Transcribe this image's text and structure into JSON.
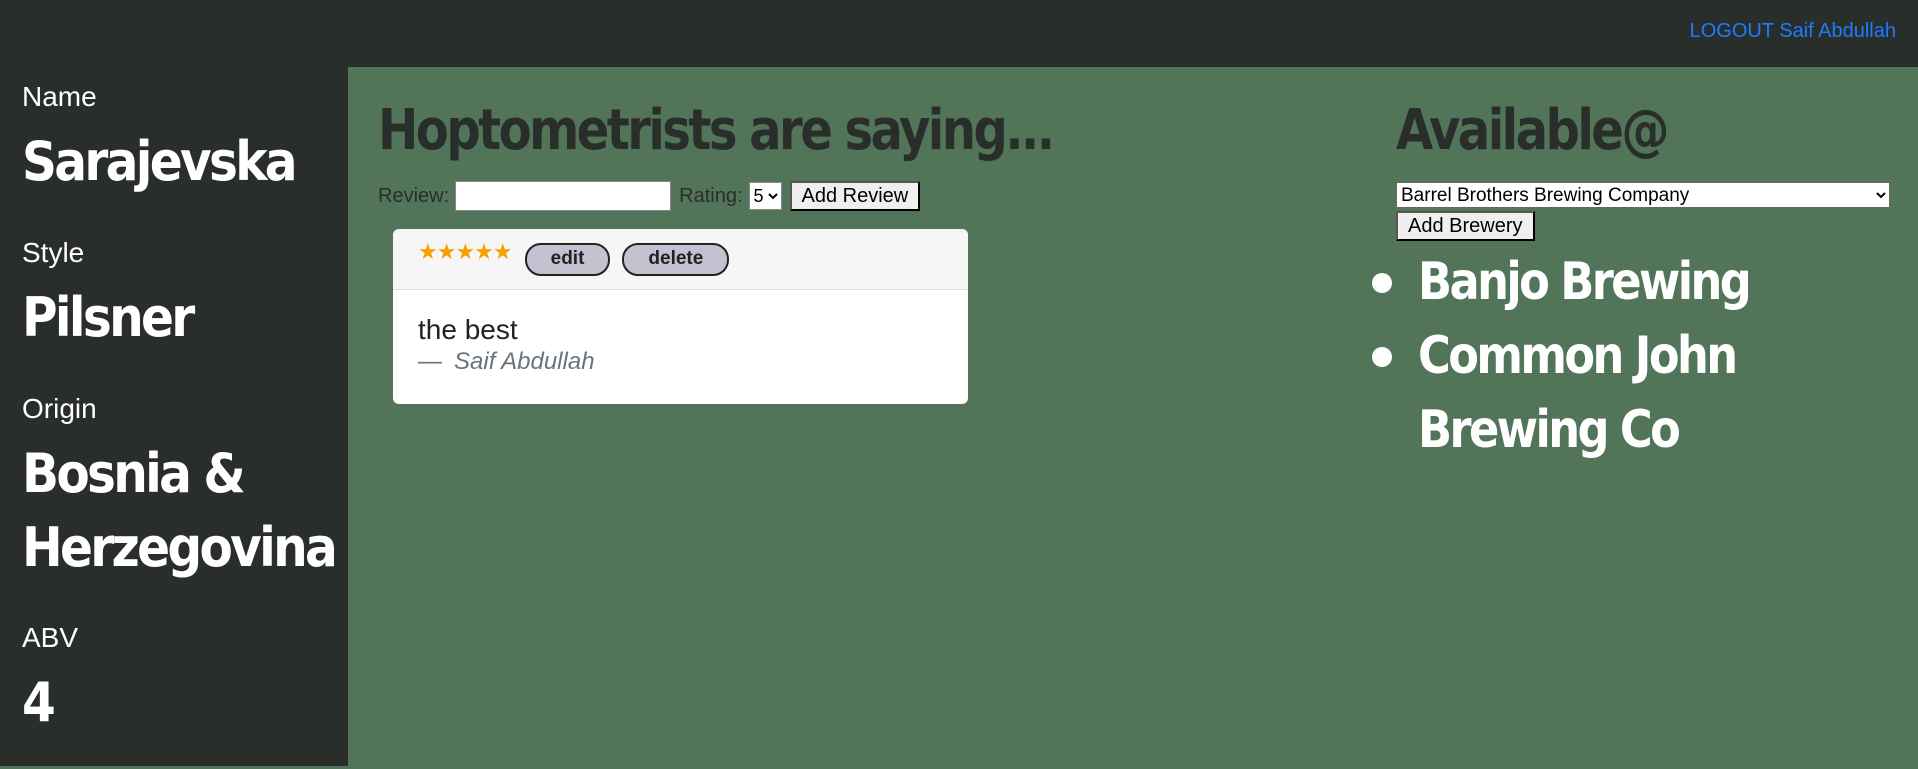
{
  "header": {
    "logout_label": "LOGOUT",
    "user_name": "Saif Abdullah"
  },
  "sidebar": {
    "name_label": "Name",
    "name_value": "Sarajevska",
    "style_label": "Style",
    "style_value": "Pilsner",
    "origin_label": "Origin",
    "origin_value": "Bosnia & Herzegovina",
    "abv_label": "ABV",
    "abv_value": "4"
  },
  "reviews": {
    "heading": "Hoptometrists are saying...",
    "review_label": "Review:",
    "review_value": "",
    "rating_label": "Rating:",
    "rating_selected": "5",
    "add_review_label": "Add Review",
    "items": [
      {
        "stars": "★★★★★",
        "rating": 5,
        "edit_label": "edit",
        "delete_label": "delete",
        "text": "the best",
        "dash": "—",
        "author": "Saif Abdullah"
      }
    ]
  },
  "availability": {
    "heading": "Available@",
    "brewery_selected": "Barrel Brothers Brewing Company",
    "add_brewery_label": "Add Brewery",
    "breweries": [
      "Banjo Brewing",
      "Common John Brewing Co"
    ]
  },
  "colors": {
    "main_bg": "#52755a",
    "dark_bg": "#2a2e2b",
    "link": "#1e7bff",
    "star": "#f5a000"
  }
}
